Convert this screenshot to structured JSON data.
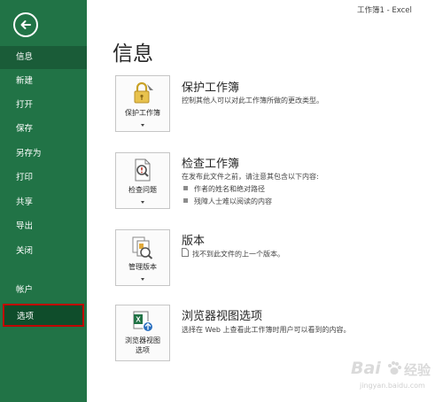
{
  "window": {
    "title": "工作簿1 - Excel"
  },
  "sidebar": {
    "items": [
      {
        "label": "信息",
        "name": "sidebar-item-info"
      },
      {
        "label": "新建",
        "name": "sidebar-item-new"
      },
      {
        "label": "打开",
        "name": "sidebar-item-open"
      },
      {
        "label": "保存",
        "name": "sidebar-item-save"
      },
      {
        "label": "另存为",
        "name": "sidebar-item-save-as"
      },
      {
        "label": "打印",
        "name": "sidebar-item-print"
      },
      {
        "label": "共享",
        "name": "sidebar-item-share"
      },
      {
        "label": "导出",
        "name": "sidebar-item-export"
      },
      {
        "label": "关闭",
        "name": "sidebar-item-close"
      },
      {
        "label": "帐户",
        "name": "sidebar-item-account"
      },
      {
        "label": "选项",
        "name": "sidebar-item-options"
      }
    ]
  },
  "main": {
    "title": "信息",
    "sections": [
      {
        "tile_label": "保护工作簿",
        "title": "保护工作簿",
        "description": "控制其他人可以对此工作簿所做的更改类型。"
      },
      {
        "tile_label": "检查问题",
        "title": "检查工作簿",
        "description": "在发布此文件之前，请注意其包含以下内容:",
        "bullets": [
          "作者的姓名和绝对路径",
          "残障人士难以阅读的内容"
        ]
      },
      {
        "tile_label": "管理版本",
        "title": "版本",
        "description": "找不到此文件的上一个版本。"
      },
      {
        "tile_label": [
          "浏览器视图",
          "选项"
        ],
        "title": "浏览器视图选项",
        "description": "选择在 Web 上查看此工作簿时用户可以看到的内容。"
      }
    ]
  },
  "watermark": {
    "brand": "Bai",
    "mark": "经验",
    "url": "jingyan.baidu.com"
  },
  "colors": {
    "sidebar": "#217346",
    "sidebar_active": "#1a5c38",
    "highlight_border": "#c00000"
  }
}
